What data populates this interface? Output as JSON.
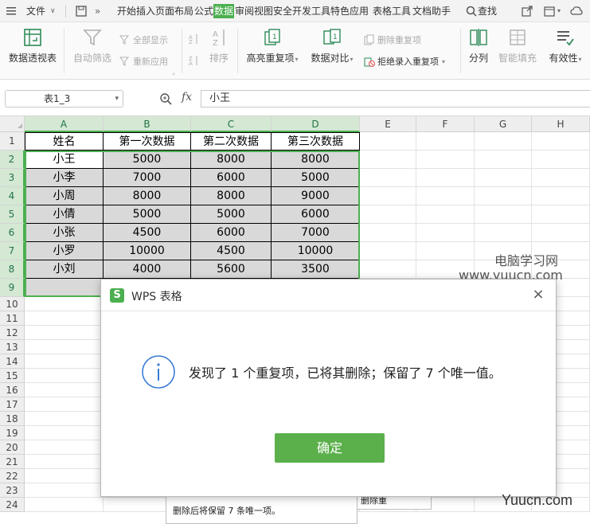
{
  "menubar": {
    "file": "文件",
    "tabs": [
      "开始",
      "插入",
      "页面布局",
      "公式",
      "数据",
      "审阅",
      "视图",
      "安全",
      "开发工具",
      "特色应用",
      "表格工具",
      "文档助手"
    ],
    "active_tab": "数据",
    "search": "查找"
  },
  "ribbon": {
    "pivot": "数据透视表",
    "autofilter": "自动筛选",
    "show_all": "全部显示",
    "reapply": "重新应用",
    "sort": "排序",
    "highlight_dup": "高亮重复项",
    "compare": "数据对比",
    "delete_dup": "删除重复项",
    "reject_dup": "拒绝录入重复项",
    "split": "分列",
    "smart_fill": "智能填充",
    "validity": "有效性"
  },
  "formula_bar": {
    "name_box": "表1_3",
    "fx": "fx",
    "content": "小王"
  },
  "sheet": {
    "columns": [
      "A",
      "B",
      "C",
      "D",
      "E",
      "F",
      "G",
      "H"
    ],
    "rows": [
      "1",
      "2",
      "3",
      "4",
      "5",
      "6",
      "7",
      "8",
      "9",
      "10",
      "11",
      "12",
      "13",
      "14",
      "15",
      "16",
      "17",
      "18",
      "19",
      "20",
      "21",
      "22",
      "23",
      "24"
    ],
    "table": [
      [
        "姓名",
        "第一次数据",
        "第二次数据",
        "第三次数据"
      ],
      [
        "小王",
        "5000",
        "8000",
        "8000"
      ],
      [
        "小李",
        "7000",
        "6000",
        "5000"
      ],
      [
        "小周",
        "8000",
        "8000",
        "9000"
      ],
      [
        "小倩",
        "5000",
        "5000",
        "6000"
      ],
      [
        "小张",
        "4500",
        "6000",
        "7000"
      ],
      [
        "小罗",
        "10000",
        "4500",
        "10000"
      ],
      [
        "小刘",
        "4000",
        "5600",
        "3500"
      ]
    ]
  },
  "background_panel": {
    "text": "删除后将保留 7 条唯一项。",
    "side": "删除重"
  },
  "dialog": {
    "title": "WPS 表格",
    "logo": "S",
    "message": "发现了 1 个重复项，已将其删除；保留了 7 个唯一值。",
    "ok": "确定",
    "close": "×"
  },
  "watermarks": {
    "line1": "电脑学习网",
    "line2": "www.yuucn.com",
    "line3": "Yuucn.com"
  },
  "colors": {
    "accent": "#4caf50",
    "ok_button": "#5cb04c",
    "info_icon": "#3a7bd5"
  }
}
